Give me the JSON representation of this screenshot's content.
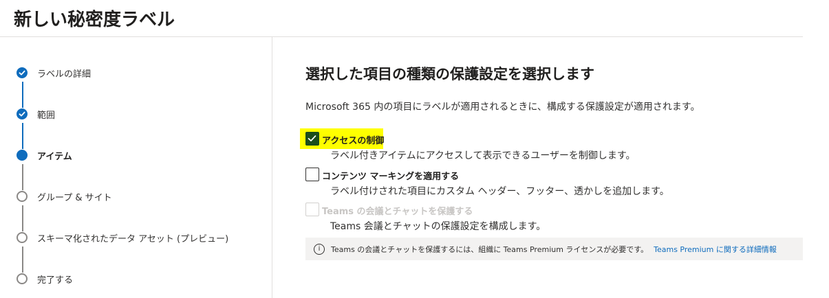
{
  "page": {
    "title": "新しい秘密度ラベル"
  },
  "colors": {
    "accent": "#0f6cbd",
    "checked": "#1b4d1b",
    "highlight": "#ffff00",
    "info_background": "#f3f2f1"
  },
  "stepper": {
    "steps": [
      {
        "label": "ラベルの詳細",
        "state": "done"
      },
      {
        "label": "範囲",
        "state": "done"
      },
      {
        "label": "アイテム",
        "state": "current"
      },
      {
        "label": "グループ & サイト",
        "state": "todo"
      },
      {
        "label": "スキーマ化されたデータ アセット (プレビュー)",
        "state": "todo"
      },
      {
        "label": "完了する",
        "state": "todo"
      }
    ]
  },
  "main": {
    "heading": "選択した項目の種類の保護設定を選択します",
    "description": "Microsoft 365 内の項目にラベルが適用されるときに、構成する保護設定が適用されます。",
    "options": [
      {
        "title": "アクセスの制御",
        "description": "ラベル付きアイテムにアクセスして表示できるユーザーを制御します。",
        "checked": true,
        "disabled": false
      },
      {
        "title": "コンテンツ マーキングを適用する",
        "description": "ラベル付けされた項目にカスタム ヘッダー、フッター、透かしを追加します。",
        "checked": false,
        "disabled": false
      },
      {
        "title": "Teams の会議とチャットを保護する",
        "description": "Teams 会議とチャットの保護設定を構成します。",
        "checked": false,
        "disabled": true
      }
    ],
    "info": {
      "icon": "info-icon",
      "text": "Teams の会議とチャットを保護するには、組織に Teams Premium ライセンスが必要です。",
      "link": "Teams Premium に関する詳細情報"
    }
  }
}
